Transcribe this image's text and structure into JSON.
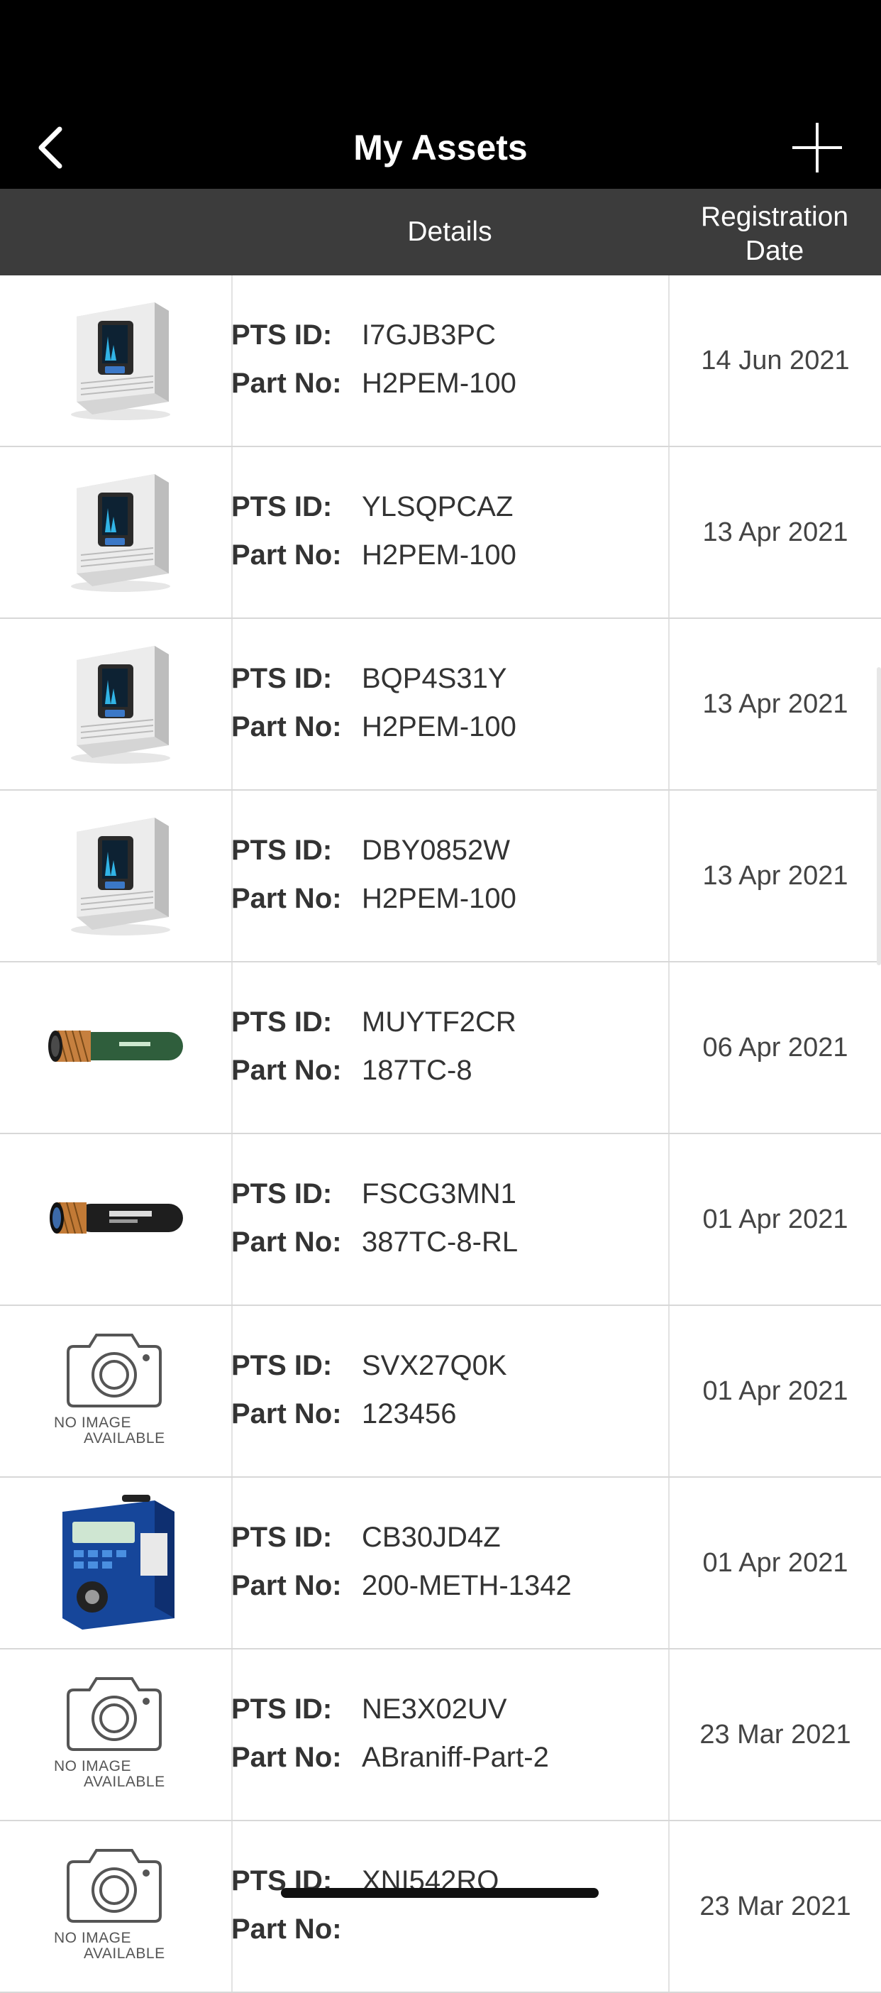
{
  "nav": {
    "title": "My Assets",
    "back_icon": "chevron-left-icon",
    "add_icon": "plus-icon"
  },
  "header": {
    "details": "Details",
    "reg_date_line1": "Registration",
    "reg_date_line2": "Date"
  },
  "labels": {
    "pts_id": "PTS ID:",
    "part_no": "Part No:",
    "no_image_line1": "NO IMAGE",
    "no_image_line2": "AVAILABLE"
  },
  "assets": [
    {
      "image": "hydrogen-generator",
      "pts_id": "I7GJB3PC",
      "part_no": "H2PEM-100",
      "date": "14 Jun 2021"
    },
    {
      "image": "hydrogen-generator",
      "pts_id": "YLSQPCAZ",
      "part_no": "H2PEM-100",
      "date": "13 Apr 2021"
    },
    {
      "image": "hydrogen-generator",
      "pts_id": "BQP4S31Y",
      "part_no": "H2PEM-100",
      "date": "13 Apr 2021"
    },
    {
      "image": "hydrogen-generator",
      "pts_id": "DBY0852W",
      "part_no": "H2PEM-100",
      "date": "13 Apr 2021"
    },
    {
      "image": "hose-green",
      "pts_id": "MUYTF2CR",
      "part_no": "187TC-8",
      "date": "06 Apr 2021"
    },
    {
      "image": "hose-black",
      "pts_id": "FSCG3MN1",
      "part_no": "387TC-8-RL",
      "date": "01 Apr 2021"
    },
    {
      "image": "no-image",
      "pts_id": "SVX27Q0K",
      "part_no": "123456",
      "date": "01 Apr 2021"
    },
    {
      "image": "blue-instrument",
      "pts_id": "CB30JD4Z",
      "part_no": "200-METH-1342",
      "date": "01 Apr 2021"
    },
    {
      "image": "no-image",
      "pts_id": "NE3X02UV",
      "part_no": "ABraniff-Part-2",
      "date": "23 Mar 2021"
    },
    {
      "image": "no-image",
      "pts_id": "XNI542RO",
      "part_no": "",
      "date": "23 Mar 2021"
    }
  ]
}
